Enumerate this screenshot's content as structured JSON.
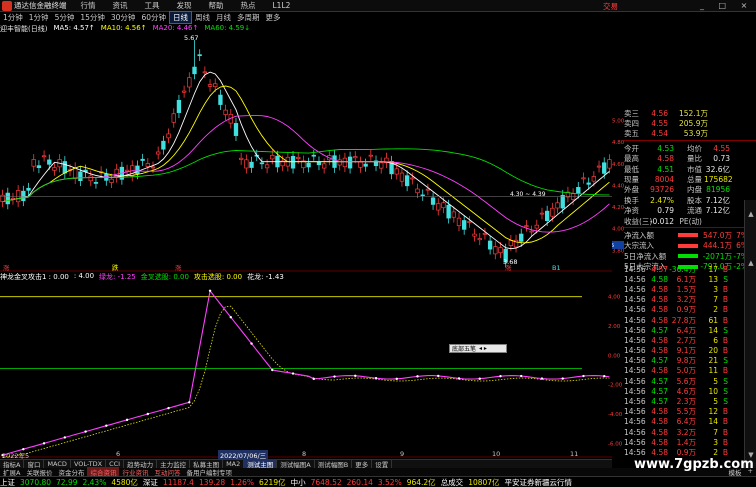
{
  "titlebar": {
    "app_title": "通达信金融终端",
    "menus": [
      "行情",
      "资讯",
      "工具",
      "发现",
      "帮助",
      "热点",
      "L1L2"
    ],
    "trade": "交易",
    "window_buttons": "_ □ ×"
  },
  "period_bar": [
    "1分钟",
    "1分钟",
    "5分钟",
    "15分钟",
    "30分钟",
    "60分钟",
    "日线",
    "周线",
    "月线",
    "多周期",
    "更多"
  ],
  "period_active_index": 6,
  "stock_name": "迎丰智能(日线)",
  "ma_legend": [
    {
      "label": "MA5: 4.57↑",
      "color": "#ffffff"
    },
    {
      "label": "MA10: 4.56↑",
      "color": "#ffff00"
    },
    {
      "label": "MA20: 4.46↑",
      "color": "#ff40ff"
    },
    {
      "label": "MA60: 4.59↓",
      "color": "#00e000"
    }
  ],
  "price_axis": [
    "5.00",
    "4.80",
    "4.60",
    "4.40",
    "4.20",
    "4.00",
    "3.80"
  ],
  "price_axis_highlight": "3.85",
  "chart_annotations": {
    "high_label": "5.67",
    "low_label": "3.68",
    "range_label": "4.30 ~ 4.39",
    "mark_zhang": "涨",
    "mark_jiang": "跌",
    "mark_s": "S",
    "mark_b": "B1"
  },
  "indicator_legend": [
    {
      "label": "神龙金叉攻击1 : 0.00",
      "color": "#ffffff"
    },
    {
      "label": ": 4.00",
      "color": "#ffffff"
    },
    {
      "label": "绿龙: -1.25",
      "color": "#ff40ff"
    },
    {
      "label": "金叉选股: 0.00",
      "color": "#00e000"
    },
    {
      "label": "攻击选股: 0.00",
      "color": "#ffff00"
    },
    {
      "label": "花龙: -1.43",
      "color": "#ffffff"
    }
  ],
  "indicator_axis": [
    "4.00",
    "2.00",
    "0.00",
    "-2.00",
    "-4.00",
    "-6.00"
  ],
  "popup_label": "底部五笔",
  "date_bar": {
    "left": "2022年5",
    "mid": "6",
    "sel": "2022/07/06/三",
    "c": "8",
    "d": "9",
    "e": "10",
    "f": "11"
  },
  "quote": {
    "asks": [
      {
        "label": "卖三",
        "price": "4.56",
        "vol": "152.1万"
      },
      {
        "label": "卖四",
        "price": "4.55",
        "vol": "205.9万"
      },
      {
        "label": "卖五",
        "price": "4.54",
        "vol": "53.9万"
      }
    ],
    "stats": [
      {
        "l1": "今开",
        "v1": "4.53",
        "c1": "green",
        "l2": "均价",
        "v2": "4.55",
        "c2": "red"
      },
      {
        "l1": "最高",
        "v1": "4.58",
        "c1": "red",
        "l2": "量比",
        "v2": "0.73",
        "c2": "white"
      },
      {
        "l1": "最低",
        "v1": "4.51",
        "c1": "green",
        "l2": "市值",
        "v2": "32.6亿",
        "c2": "white"
      },
      {
        "l1": "现量",
        "v1": "8004",
        "c1": "red",
        "l2": "总量",
        "v2": "175682",
        "c2": "yellow"
      },
      {
        "l1": "外盘",
        "v1": "93726",
        "c1": "red",
        "l2": "内盘",
        "v2": "81956",
        "c2": "green"
      },
      {
        "l1": "换手",
        "v1": "2.47%",
        "c1": "yellow",
        "l2": "股本",
        "v2": "7.12亿",
        "c2": "white"
      },
      {
        "l1": "净资",
        "v1": "0.79",
        "c1": "white",
        "l2": "流通",
        "v2": "7.12亿",
        "c2": "white"
      },
      {
        "l1": "收益(三)",
        "v1": "-0.012",
        "c1": "white",
        "l2": "PE(动)",
        "v2": "",
        "c2": "white"
      }
    ],
    "funds": [
      {
        "label": "净流入额",
        "value": "547.0万",
        "pct": "7%",
        "color": "#ff3b3b"
      },
      {
        "label": "大宗流入",
        "value": "444.1万",
        "pct": "6%",
        "color": "#ff3b3b"
      },
      {
        "label": "5日净流入额",
        "value": "-2071万",
        "pct": "-7%",
        "color": "#00e000"
      },
      {
        "label": "5日大宗流入",
        "value": "-797.0万",
        "pct": "-2%",
        "color": "#00e000"
      }
    ]
  },
  "ticks": [
    {
      "t": "14:56",
      "p": "4.57",
      "c": "-36.4万",
      "vol": "17",
      "bs": "B"
    },
    {
      "t": "14:56",
      "p": "4.58",
      "c": "6.1万",
      "vol": "13",
      "bs": "S"
    },
    {
      "t": "14:56",
      "p": "4.58",
      "c": "1.5万",
      "vol": "3",
      "bs": "B"
    },
    {
      "t": "14:56",
      "p": "4.58",
      "c": "3.2万",
      "vol": "7",
      "bs": "B"
    },
    {
      "t": "14:56",
      "p": "4.58",
      "c": "0.9万",
      "vol": "2",
      "bs": "B"
    },
    {
      "t": "14:56",
      "p": "4.58",
      "c": "27.8万",
      "vol": "61",
      "bs": "B"
    },
    {
      "t": "14:56",
      "p": "4.57",
      "c": "6.4万",
      "vol": "14",
      "bs": "S"
    },
    {
      "t": "14:56",
      "p": "4.58",
      "c": "2.7万",
      "vol": "6",
      "bs": "B"
    },
    {
      "t": "14:56",
      "p": "4.58",
      "c": "9.1万",
      "vol": "20",
      "bs": "B"
    },
    {
      "t": "14:56",
      "p": "4.57",
      "c": "9.8万",
      "vol": "21",
      "bs": "S"
    },
    {
      "t": "14:56",
      "p": "4.58",
      "c": "5.0万",
      "vol": "11",
      "bs": "B"
    },
    {
      "t": "14:56",
      "p": "4.57",
      "c": "5.6万",
      "vol": "5",
      "bs": "S"
    },
    {
      "t": "14:56",
      "p": "4.57",
      "c": "4.6万",
      "vol": "10",
      "bs": "S"
    },
    {
      "t": "14:56",
      "p": "4.57",
      "c": "2.3万",
      "vol": "5",
      "bs": "S"
    },
    {
      "t": "14:56",
      "p": "4.58",
      "c": "5.5万",
      "vol": "12",
      "bs": "B"
    },
    {
      "t": "14:56",
      "p": "4.58",
      "c": "6.4万",
      "vol": "14",
      "bs": "B"
    },
    {
      "t": "14:56",
      "p": "4.58",
      "c": "3.2万",
      "vol": "7",
      "bs": "B"
    },
    {
      "t": "14:56",
      "p": "4.58",
      "c": "1.4万",
      "vol": "3",
      "bs": "B"
    },
    {
      "t": "14:56",
      "p": "4.58",
      "c": "0.9万",
      "vol": "2",
      "bs": "B"
    }
  ],
  "tab_bar": [
    "指标A",
    "窗口",
    "MACD",
    "VOL-TDX",
    "CCI",
    "趋势动力",
    "主力监控",
    "私募主图",
    "MA2",
    "测试主图",
    "测试幅图A",
    "测试幅图B",
    "更多",
    "设置"
  ],
  "tab_bar_selected": 9,
  "tab_bar2": [
    "扩展A",
    "关联报价",
    "资金分布",
    "综合资讯",
    "行业资讯",
    "互动问答",
    "备用户编制专项"
  ],
  "tab_bar2_selected": 3,
  "tab_bar2_right": [
    "模板",
    "+"
  ],
  "statusbar": [
    {
      "text": "上证",
      "color": "#ffffff"
    },
    {
      "text": "3070.80",
      "color": "#00e000"
    },
    {
      "text": "72.99",
      "color": "#00e000"
    },
    {
      "text": "2.43%",
      "color": "#00e000"
    },
    {
      "text": "4580亿",
      "color": "#e8e800"
    },
    {
      "text": "深证",
      "color": "#ffffff"
    },
    {
      "text": "11187.4",
      "color": "#ff3b3b"
    },
    {
      "text": "139.28",
      "color": "#ff3b3b"
    },
    {
      "text": "1.26%",
      "color": "#ff3b3b"
    },
    {
      "text": "6219亿",
      "color": "#e8e800"
    },
    {
      "text": "中小",
      "color": "#ffffff"
    },
    {
      "text": "7648.52",
      "color": "#ff3b3b"
    },
    {
      "text": "260.14",
      "color": "#ff3b3b"
    },
    {
      "text": "3.52%",
      "color": "#ff3b3b"
    },
    {
      "text": "964.2亿",
      "color": "#e8e800"
    },
    {
      "text": "总成交",
      "color": "#ffffff"
    },
    {
      "text": "10807亿",
      "color": "#e8e800"
    },
    {
      "text": "平安证券新疆云行情",
      "color": "#ffffff"
    }
  ],
  "watermark": "www.7gpzb.com"
}
